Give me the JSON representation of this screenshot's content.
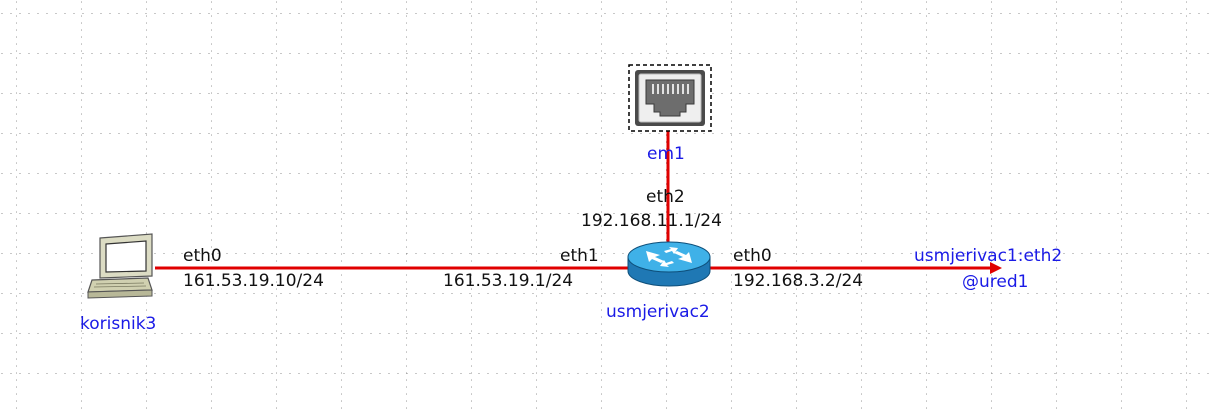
{
  "colors": {
    "link": "#e00000",
    "node_label": "#1a1ae6",
    "text": "#111111"
  },
  "nodes": {
    "em1": {
      "name": "em1",
      "icon": "ethernet-port-icon"
    },
    "korisnik3": {
      "name": "korisnik3",
      "icon": "pc-icon"
    },
    "usmjerivac2": {
      "name": "usmjerivac2",
      "icon": "router-icon"
    },
    "external": {
      "name": "usmjerivac1:eth2",
      "sub": "@ured1"
    }
  },
  "links": {
    "korisnik3_usmjerivac2": {
      "left_if": "eth0",
      "left_ip": "161.53.19.10/24",
      "right_if": "eth1",
      "right_ip": "161.53.19.1/24"
    },
    "usmjerivac2_em1": {
      "if": "eth2",
      "ip": "192.168.11.1/24"
    },
    "usmjerivac2_external": {
      "if": "eth0",
      "ip": "192.168.3.2/24"
    }
  }
}
